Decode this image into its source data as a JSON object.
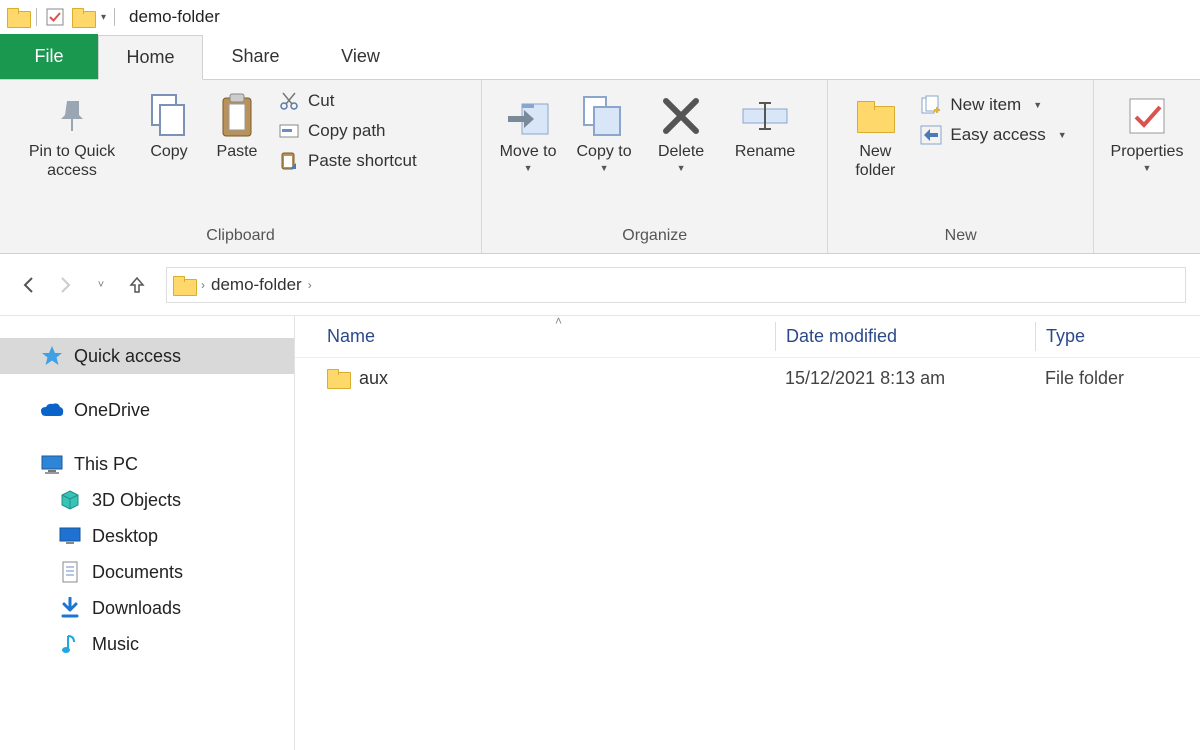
{
  "titlebar": {
    "title": "demo-folder"
  },
  "tabs": {
    "file": "File",
    "home": "Home",
    "share": "Share",
    "view": "View"
  },
  "ribbon": {
    "clipboard": {
      "label": "Clipboard",
      "pin": "Pin to Quick access",
      "copy": "Copy",
      "paste": "Paste",
      "cut": "Cut",
      "copy_path": "Copy path",
      "paste_shortcut": "Paste shortcut"
    },
    "organize": {
      "label": "Organize",
      "move_to": "Move to",
      "copy_to": "Copy to",
      "delete": "Delete",
      "rename": "Rename"
    },
    "new": {
      "label": "New",
      "new_folder": "New folder",
      "new_item": "New item",
      "easy_access": "Easy access"
    },
    "open": {
      "properties": "Properties"
    }
  },
  "breadcrumb": {
    "current": "demo-folder"
  },
  "navpane": {
    "quick_access": "Quick access",
    "onedrive": "OneDrive",
    "this_pc": "This PC",
    "objects_3d": "3D Objects",
    "desktop": "Desktop",
    "documents": "Documents",
    "downloads": "Downloads",
    "music": "Music"
  },
  "columns": {
    "name": "Name",
    "date": "Date modified",
    "type": "Type"
  },
  "files": [
    {
      "name": "aux",
      "date": "15/12/2021 8:13 am",
      "type": "File folder"
    }
  ]
}
